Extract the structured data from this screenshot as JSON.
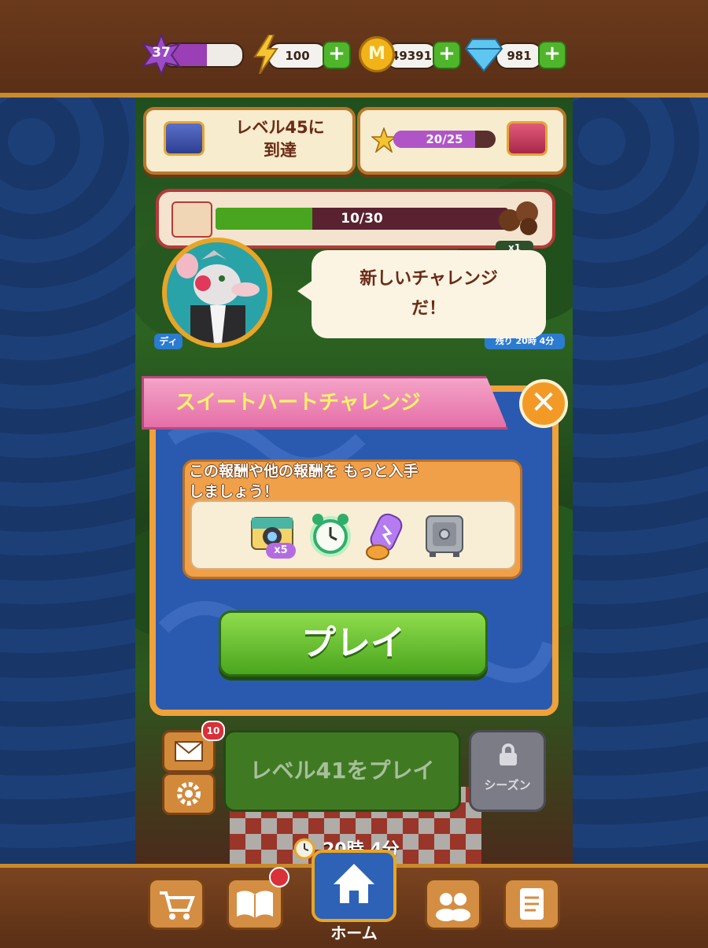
{
  "hud": {
    "level": "37",
    "energy": "100",
    "coins": "49391",
    "gems": "981",
    "coin_letter": "M"
  },
  "cards": {
    "goal_text": "レベル45に\n到達",
    "stars_progress": "20/25",
    "stars_fraction": 0.8
  },
  "event": {
    "progress": "10/30",
    "progress_fraction": 0.333,
    "multiplier": "x1",
    "left_tag": "ディ",
    "right_time": "残り 20時 4分"
  },
  "character": {
    "speech": "新しいチャレンジ\nだ！"
  },
  "dialog": {
    "title": "スイートハートチャレンジ",
    "close_symbol": "✕",
    "reward_text": "この報酬や他の報酬を もっと入手\nしましょう！",
    "items": [
      {
        "name": "camera",
        "badge": "x5"
      },
      {
        "name": "alarm-clock",
        "badge": ""
      },
      {
        "name": "lightning-jar",
        "badge": ""
      },
      {
        "name": "safe",
        "badge": ""
      }
    ],
    "play_label": "プレイ"
  },
  "main": {
    "mail_badge": "10",
    "level_play_label": "レベル41をプレイ",
    "season_label": "シーズン",
    "timer": "20時 4分"
  },
  "nav": {
    "home_label": "ホーム"
  },
  "colors": {
    "frame_brown": "#5a2f16",
    "gold": "#e8a526",
    "dialog_blue": "#2a5ab0",
    "play_green": "#4aa51e",
    "ribbon_pink": "#e56fa8"
  }
}
